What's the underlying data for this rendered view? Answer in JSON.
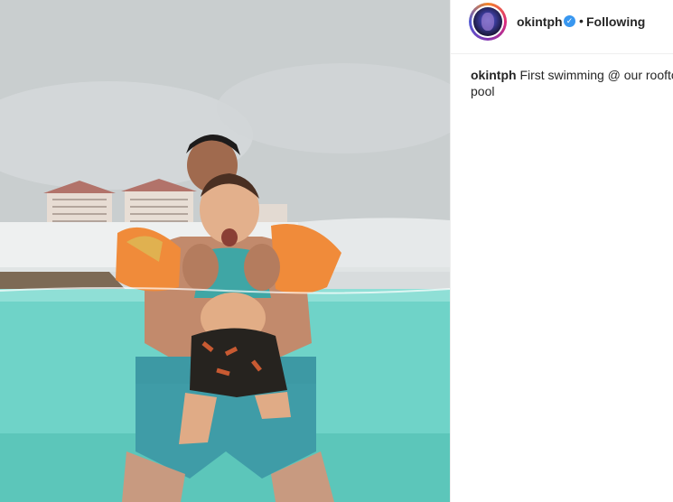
{
  "post": {
    "photo": {
      "description_icon": "photo"
    },
    "header": {
      "username": "okintph",
      "verified_icon": "verified-badge-icon",
      "separator": "•",
      "follow_label": "Following"
    },
    "caption": {
      "username": "okintph",
      "text_line1": "First swimming @ our rooftop",
      "text_line2": "pool"
    }
  },
  "colors": {
    "verified": "#3897f0",
    "text": "#262626",
    "pool": "#6ad0c6"
  }
}
